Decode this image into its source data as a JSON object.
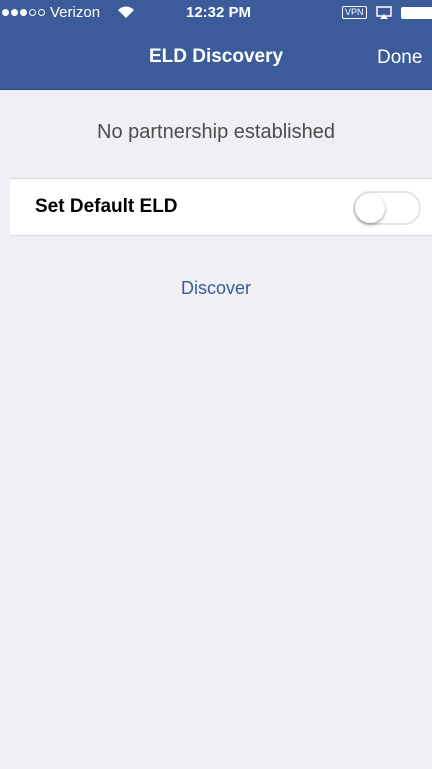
{
  "status_bar": {
    "carrier": "Verizon",
    "time": "12:32 PM",
    "vpn": "VPN",
    "signal_icon": "signal-dots-icon",
    "wifi_icon": "wifi-icon",
    "airplay_icon": "airplay-icon",
    "battery_icon": "battery-icon",
    "signal_strength": 3,
    "signal_max": 5
  },
  "nav": {
    "title": "ELD Discovery",
    "done_label": "Done"
  },
  "info": {
    "message": "No partnership established"
  },
  "settings": {
    "default_eld_label": "Set Default ELD",
    "default_eld_enabled": false
  },
  "actions": {
    "discover_label": "Discover"
  },
  "colors": {
    "nav_background": "#3b5b9a",
    "page_background": "#efeff4",
    "link": "#3b5b9a"
  }
}
